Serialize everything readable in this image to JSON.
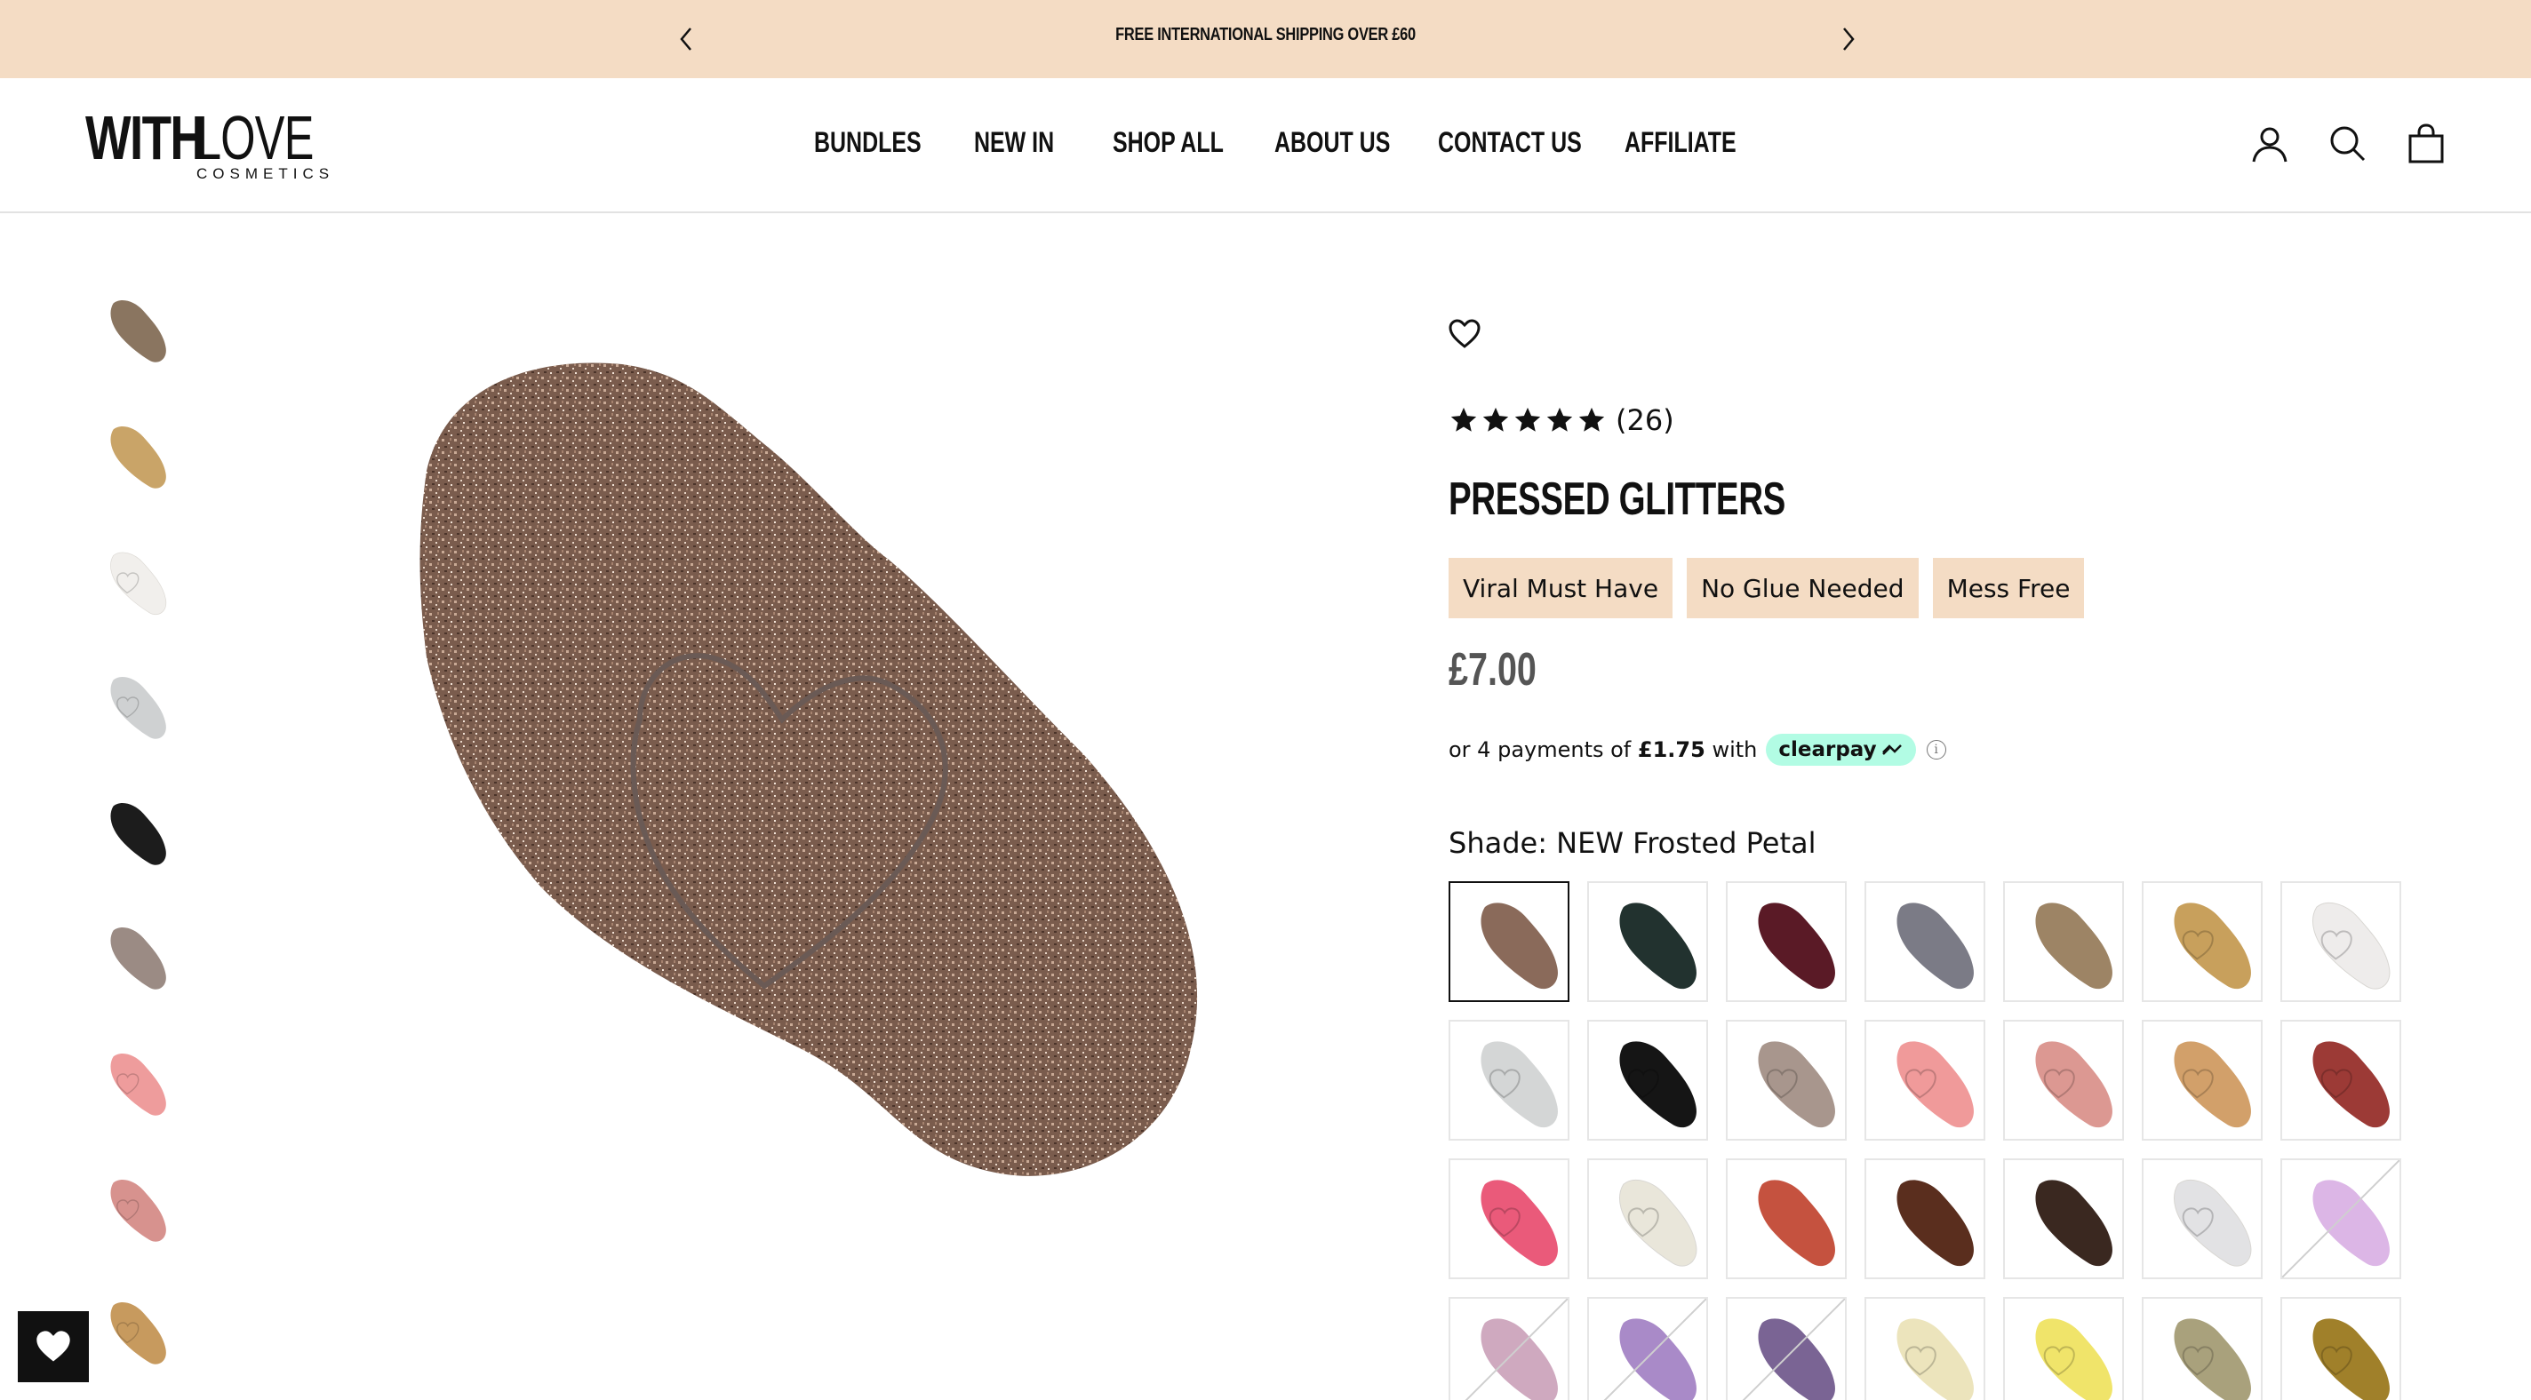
{
  "announcement": {
    "message": "FREE INTERNATIONAL SHIPPING OVER £60"
  },
  "header": {
    "logo_word_1": "WITH",
    "logo_word_2": "LOVE",
    "logo_sub": "COSMETICS",
    "nav": [
      "BUNDLES",
      "NEW IN",
      "SHOP ALL",
      "ABOUT US",
      "CONTACT US",
      "AFFILIATE"
    ]
  },
  "icons": {
    "account": "account-icon",
    "search": "search-icon",
    "cart": "bag-icon",
    "wishlist": "heart-outline-icon",
    "favourites": "heart-filled-icon"
  },
  "product": {
    "rating_stars": 5,
    "review_count": "(26)",
    "title": "PRESSED GLITTERS",
    "tags": [
      "Viral Must Have",
      "No Glue Needed",
      "Mess Free"
    ],
    "price": "£7.00",
    "payment": {
      "prefix": "or 4 payments of ",
      "amount": "£1.75",
      "suffix": " with",
      "provider": "clearpay"
    },
    "shade_label": "Shade: NEW Frosted Petal"
  },
  "thumbnail_colors": [
    "#8a7560",
    "#c9a468",
    "#f1efec",
    "#cfd1d2",
    "#1c1c1c",
    "#9b8b84",
    "#ee9c9c",
    "#d7928e",
    "#c79a5e"
  ],
  "swatches": [
    {
      "color": "#8a6a5a",
      "heart": false,
      "sold_out": false
    },
    {
      "color": "#22322f",
      "heart": false,
      "sold_out": false
    },
    {
      "color": "#5a1a26",
      "heart": false,
      "sold_out": false
    },
    {
      "color": "#7b7b86",
      "heart": false,
      "sold_out": false
    },
    {
      "color": "#9d8465",
      "heart": false,
      "sold_out": false
    },
    {
      "color": "#c8a05c",
      "heart": true,
      "sold_out": false
    },
    {
      "color": "#eeeceb",
      "heart": true,
      "sold_out": false
    },
    {
      "color": "#d4d6d6",
      "heart": true,
      "sold_out": false
    },
    {
      "color": "#151515",
      "heart": true,
      "sold_out": false
    },
    {
      "color": "#a8968d",
      "heart": true,
      "sold_out": false
    },
    {
      "color": "#f09a9a",
      "heart": true,
      "sold_out": false
    },
    {
      "color": "#dc9892",
      "heart": true,
      "sold_out": false
    },
    {
      "color": "#d2a06a",
      "heart": true,
      "sold_out": false
    },
    {
      "color": "#9c3a36",
      "heart": true,
      "sold_out": false
    },
    {
      "color": "#ea5a7a",
      "heart": true,
      "sold_out": false
    },
    {
      "color": "#e9e6da",
      "heart": true,
      "sold_out": false
    },
    {
      "color": "#c5523f",
      "heart": false,
      "sold_out": false
    },
    {
      "color": "#5a2e1e",
      "heart": false,
      "sold_out": false
    },
    {
      "color": "#3a2820",
      "heart": false,
      "sold_out": false
    },
    {
      "color": "#e2e2e4",
      "heart": true,
      "sold_out": false
    },
    {
      "color": "#dcb6e6",
      "heart": false,
      "sold_out": true
    },
    {
      "color": "#cfa9bf",
      "heart": false,
      "sold_out": true
    },
    {
      "color": "#a98ac8",
      "heart": false,
      "sold_out": true
    },
    {
      "color": "#7a6494",
      "heart": false,
      "sold_out": true
    },
    {
      "color": "#ece4bc",
      "heart": true,
      "sold_out": false
    },
    {
      "color": "#f0e46a",
      "heart": true,
      "sold_out": false
    },
    {
      "color": "#a9a17c",
      "heart": true,
      "sold_out": false
    },
    {
      "color": "#a0802a",
      "heart": true,
      "sold_out": false
    }
  ],
  "colors": {
    "announcement_bg": "#f4dcc4",
    "tag_bg": "#f4dcc4",
    "clearpay_bg": "#b2fce4",
    "main_glitter": "#7e6153"
  }
}
